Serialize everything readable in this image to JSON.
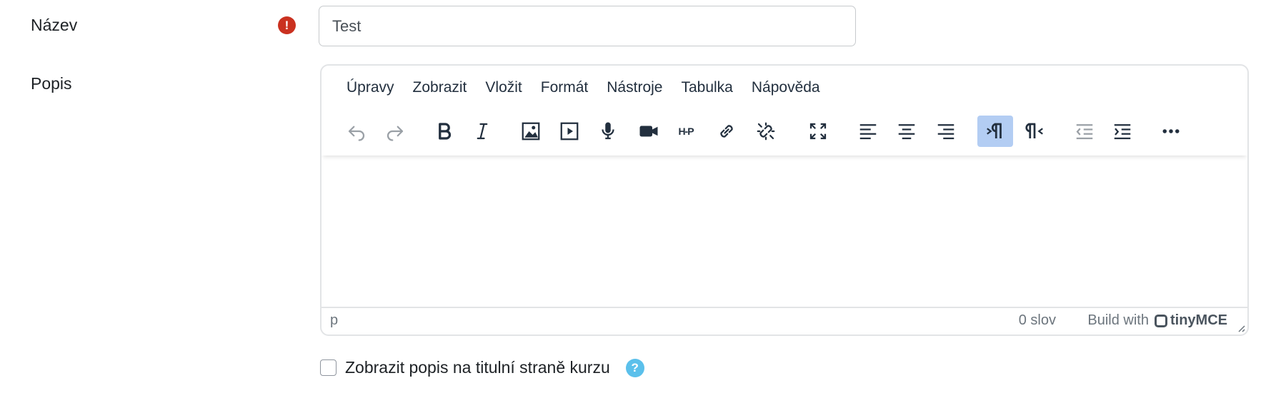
{
  "name_field": {
    "label": "Název",
    "value": "Test",
    "required_icon": "exclamation-icon"
  },
  "description_field": {
    "label": "Popis"
  },
  "editor": {
    "menu": [
      "Úpravy",
      "Zobrazit",
      "Vložit",
      "Formát",
      "Nástroje",
      "Tabulka",
      "Nápověda"
    ],
    "toolbar": [
      "undo-icon",
      "redo-icon",
      "bold-icon",
      "italic-icon",
      "image-icon",
      "media-icon",
      "microphone-icon",
      "video-icon",
      "h5p-icon",
      "link-icon",
      "unlink-icon",
      "fullscreen-icon",
      "align-left-icon",
      "align-center-icon",
      "align-right-icon",
      "ltr-icon",
      "rtl-icon",
      "outdent-icon",
      "indent-icon",
      "more-icon"
    ],
    "h5p_text": "H-P",
    "status_path": "p",
    "word_count": "0 slov",
    "build_with": "Build with",
    "brand": "tinyMCE"
  },
  "show_description": {
    "label": "Zobrazit popis na titulní straně kurzu",
    "checked": false
  },
  "colors": {
    "required": "#ca3120",
    "help": "#5bc0eb",
    "active_button": "#b3cdf3"
  }
}
